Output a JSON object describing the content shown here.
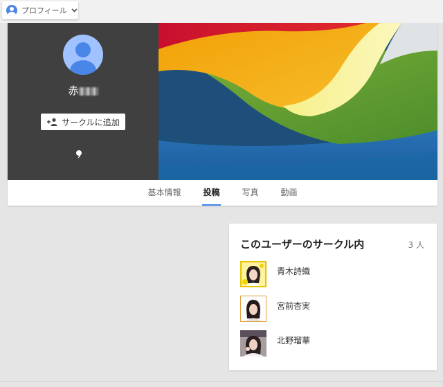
{
  "topbar": {
    "profile_switch_label": "プロフィール",
    "profile_icon": "person-icon",
    "dropdown_icon": "chevron-down-icon"
  },
  "profile": {
    "name_visible": "赤",
    "add_circle_label": "サークルに追加",
    "add_icon": "person-add-icon",
    "quote_icon": "tagline-icon"
  },
  "tabs": [
    {
      "label": "基本情報",
      "active": false
    },
    {
      "label": "投稿",
      "active": true
    },
    {
      "label": "写真",
      "active": false
    },
    {
      "label": "動画",
      "active": false
    }
  ],
  "circles": {
    "title": "このユーザーのサークル内",
    "count": "3 人",
    "members": [
      {
        "name": "青木詩織"
      },
      {
        "name": "宮前杏実"
      },
      {
        "name": "北野瑠華"
      }
    ]
  },
  "colors": {
    "accent": "#4285f4",
    "avatar_bg": "#a0c3ff",
    "avatar_fg": "#4a86e8",
    "left_panel": "#404040"
  }
}
